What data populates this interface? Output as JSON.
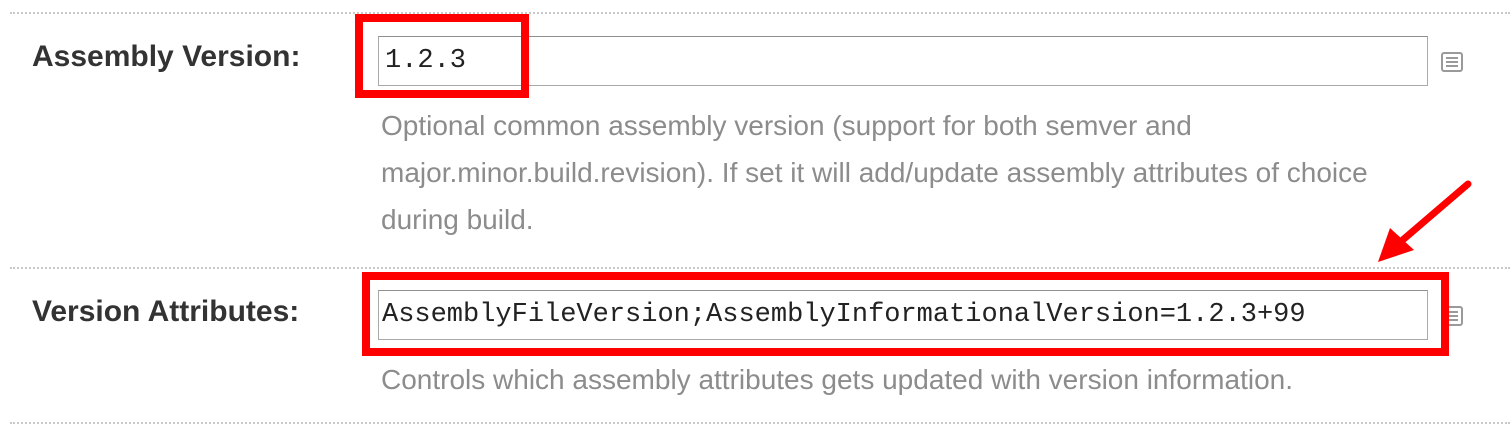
{
  "fields": [
    {
      "label": "Assembly Version:",
      "value": "1.2.3",
      "help": "Optional common assembly version (support for both semver and major.minor.build.revision). If set it will add/update assembly attributes of choice during build."
    },
    {
      "label": "Version Attributes:",
      "value": "AssemblyFileVersion;AssemblyInformationalVersion=1.2.3+99",
      "help": "Controls which assembly attributes gets updated with version information."
    }
  ],
  "annotation": {
    "color": "#ff0000",
    "arrow_target": "Version Attributes input"
  },
  "icons": {
    "help": "help-list-icon"
  }
}
